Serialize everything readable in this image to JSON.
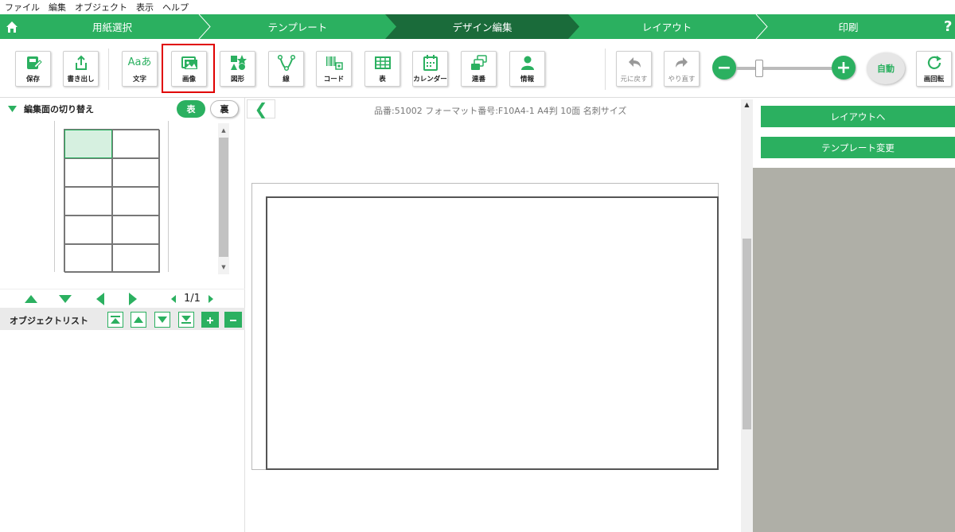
{
  "menu": [
    "ファイル",
    "編集",
    "オブジェクト",
    "表示",
    "ヘルプ"
  ],
  "steps": [
    {
      "label": "用紙選択",
      "active": false
    },
    {
      "label": "テンプレート",
      "active": false
    },
    {
      "label": "デザイン編集",
      "active": true
    },
    {
      "label": "レイアウト",
      "active": false
    },
    {
      "label": "印刷",
      "active": false
    }
  ],
  "help_label": "?",
  "toolbar": {
    "save": "保存",
    "export": "書き出し",
    "text": "文字",
    "text_icon": "Aaあ",
    "image": "画像",
    "shape": "図形",
    "line": "線",
    "code": "コード",
    "table": "表",
    "calendar": "カレンダー",
    "serial": "連番",
    "info": "情報",
    "undo": "元に戻す",
    "redo": "やり直す",
    "zoom_out": "−",
    "zoom_in": "+",
    "auto": "自動",
    "rotate": "画回転"
  },
  "left": {
    "title": "編集面の切り替え",
    "front": "表",
    "back": "裏",
    "page": "1/1",
    "object_list": "オブジェクトリスト"
  },
  "canvas": {
    "info": "品番:51002 フォーマット番号:F10A4-1 A4判 10面 名刺サイズ",
    "collapse": "❮"
  },
  "right": {
    "to_layout": "レイアウトへ",
    "change_template": "テンプレート変更"
  },
  "colors": {
    "brand": "#2bb060",
    "active_step": "#1a6b3a",
    "highlight": "#e00000"
  }
}
